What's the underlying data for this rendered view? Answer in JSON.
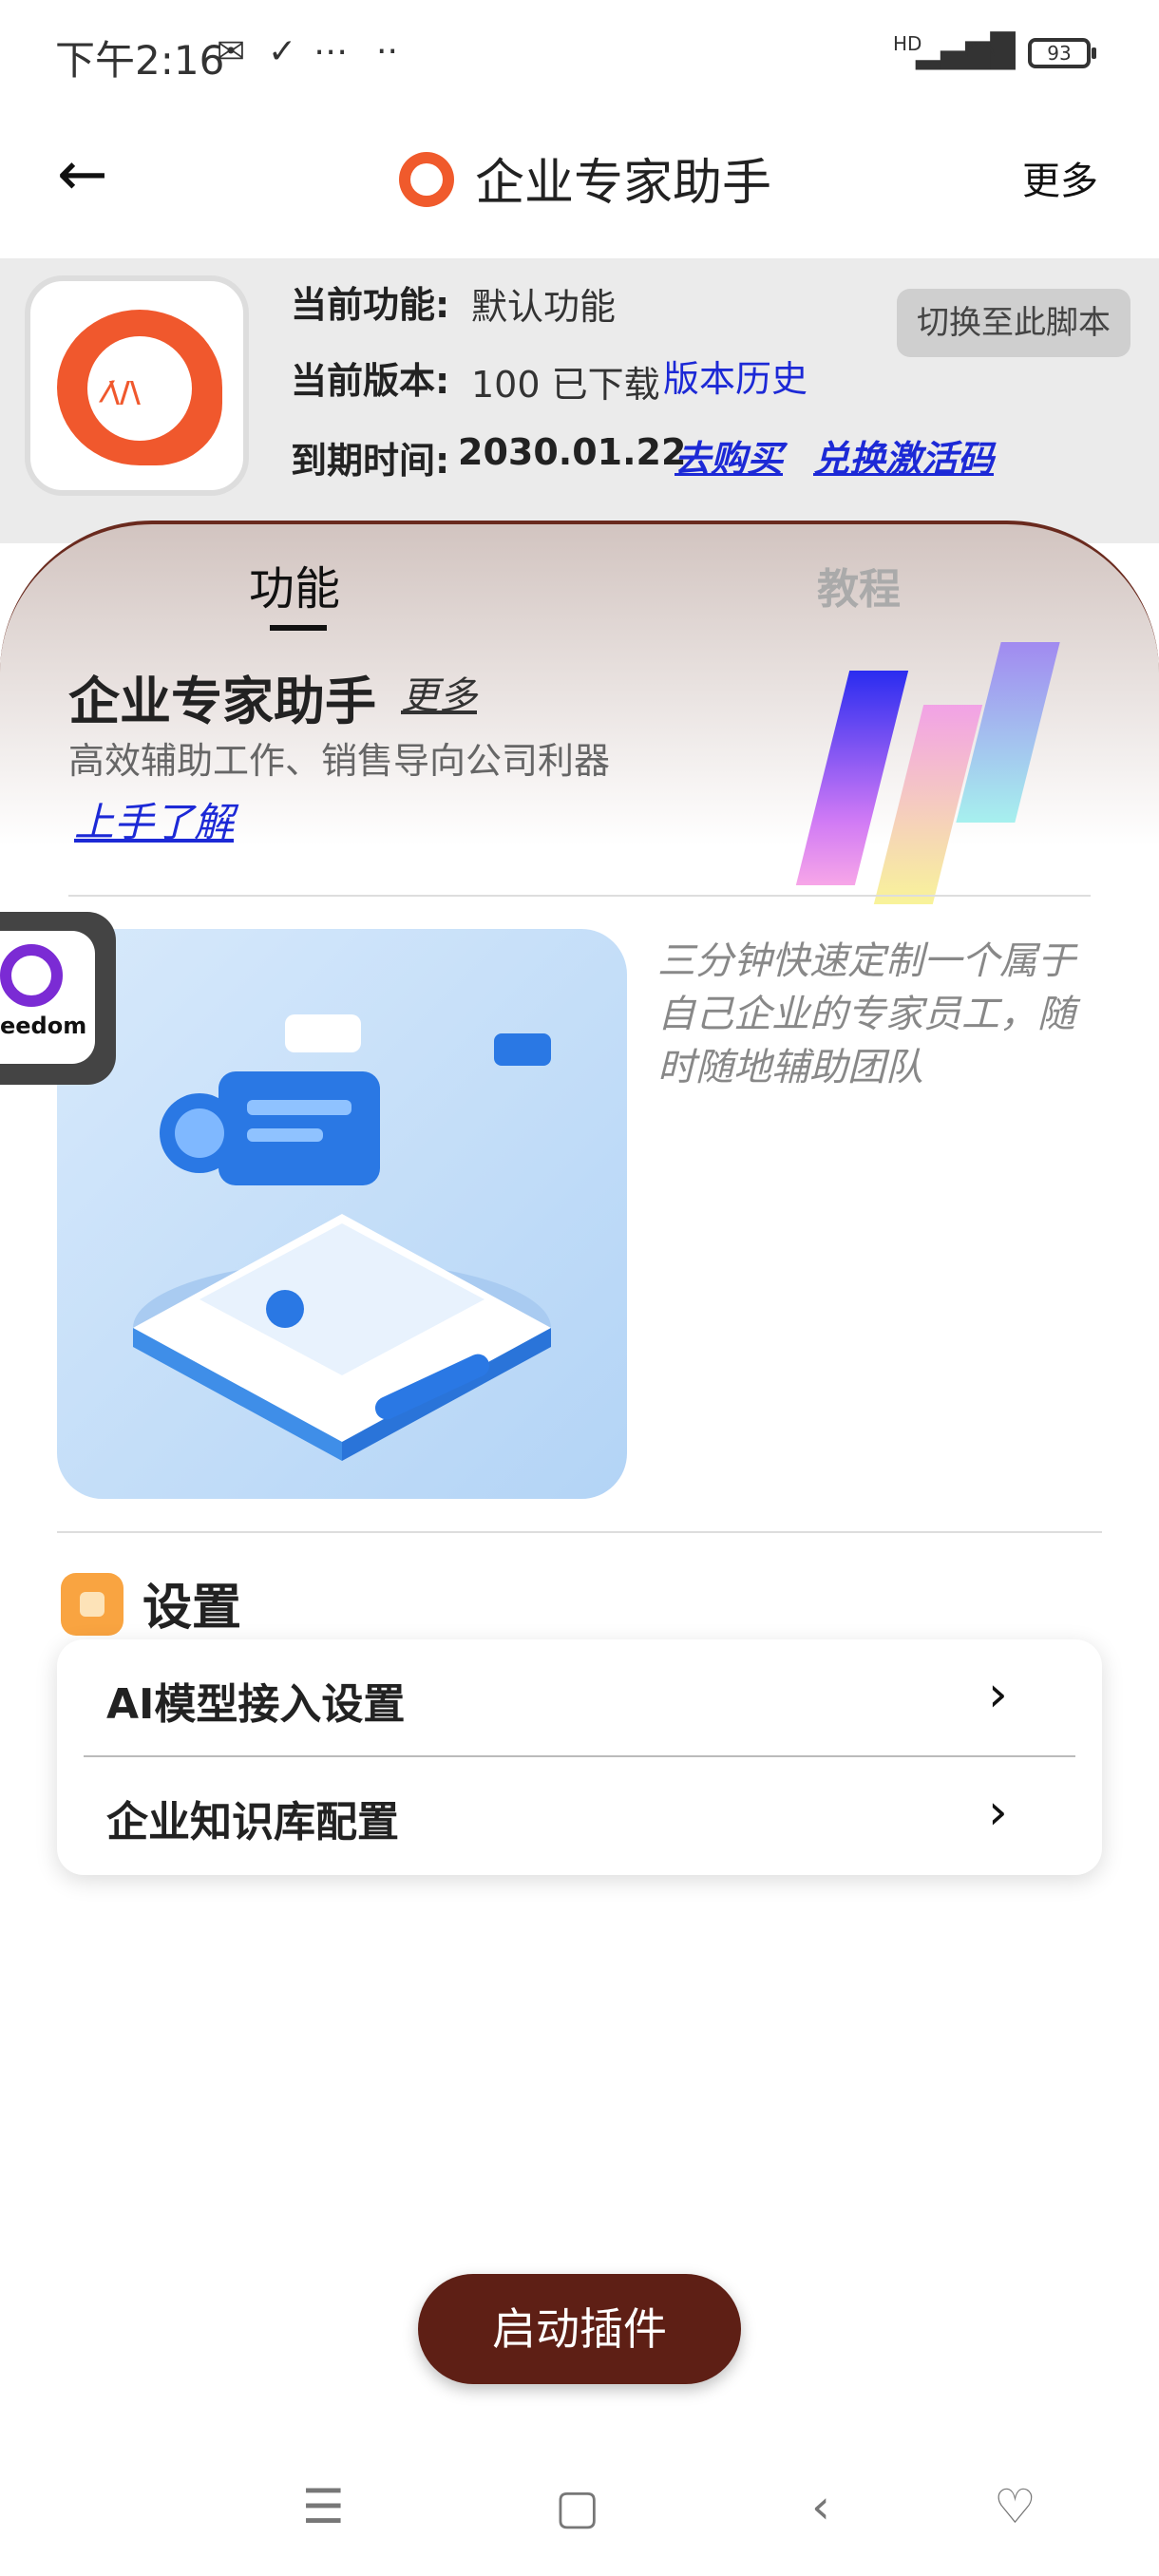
{
  "status_bar": {
    "time": "下午2:16",
    "network": "HD",
    "battery": "93"
  },
  "header": {
    "title": "企业专家助手",
    "more": "更多"
  },
  "info": {
    "feature_label": "当前功能:",
    "feature_value": "默认功能",
    "version_label": "当前版本:",
    "version_value": "100 已下载",
    "version_history": "版本历史",
    "expire_label": "到期时间:",
    "expire_value": "2030.01.22",
    "buy": "去购买",
    "redeem": "兑换激活码",
    "switch_button": "切换至此脚本"
  },
  "tabs": [
    {
      "label": "功能"
    },
    {
      "label": "教程"
    }
  ],
  "feature": {
    "title": "企业专家助手",
    "more": "更多",
    "subtitle": "高效辅助工作、销售导向公司利器",
    "learn": "上手了解",
    "description": "三分钟快速定制一个属于自己企业的专家员工，随时随地辅助团队",
    "float_badge": "eedom"
  },
  "settings": {
    "title": "设置",
    "items": [
      {
        "label": "AI模型接入设置"
      },
      {
        "label": "企业知识库配置"
      }
    ]
  },
  "start_button": "启动插件",
  "colors": {
    "accent": "#f0582d",
    "link": "#1c29d6",
    "start_button": "#5e1f15"
  }
}
